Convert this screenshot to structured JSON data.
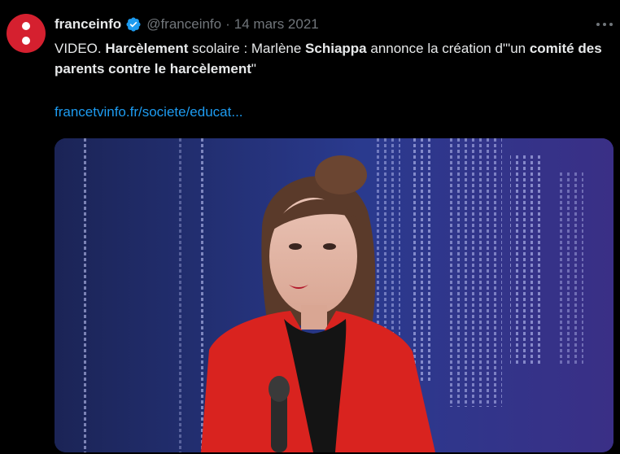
{
  "account": {
    "name": "franceinfo",
    "handle": "@franceinfo",
    "separator": "·",
    "date": "14 mars 2021"
  },
  "tweet": {
    "t1": "VIDEO. ",
    "t2": "Harcèlement",
    "t3": " scolaire : Marlène ",
    "t4": "Schiappa",
    "t5": " annonce la création d'\"un ",
    "t6": "comité des parents contre le harcèlement",
    "t7": "\"",
    "link": "francetvinfo.fr/societe/educat..."
  },
  "icons": {
    "avatar": "franceinfo-logo-icon",
    "verified": "verified-badge-icon",
    "more": "more-options-icon"
  },
  "colors": {
    "accent": "#1d9bf0",
    "brand": "#d5202f",
    "background": "#000000"
  }
}
